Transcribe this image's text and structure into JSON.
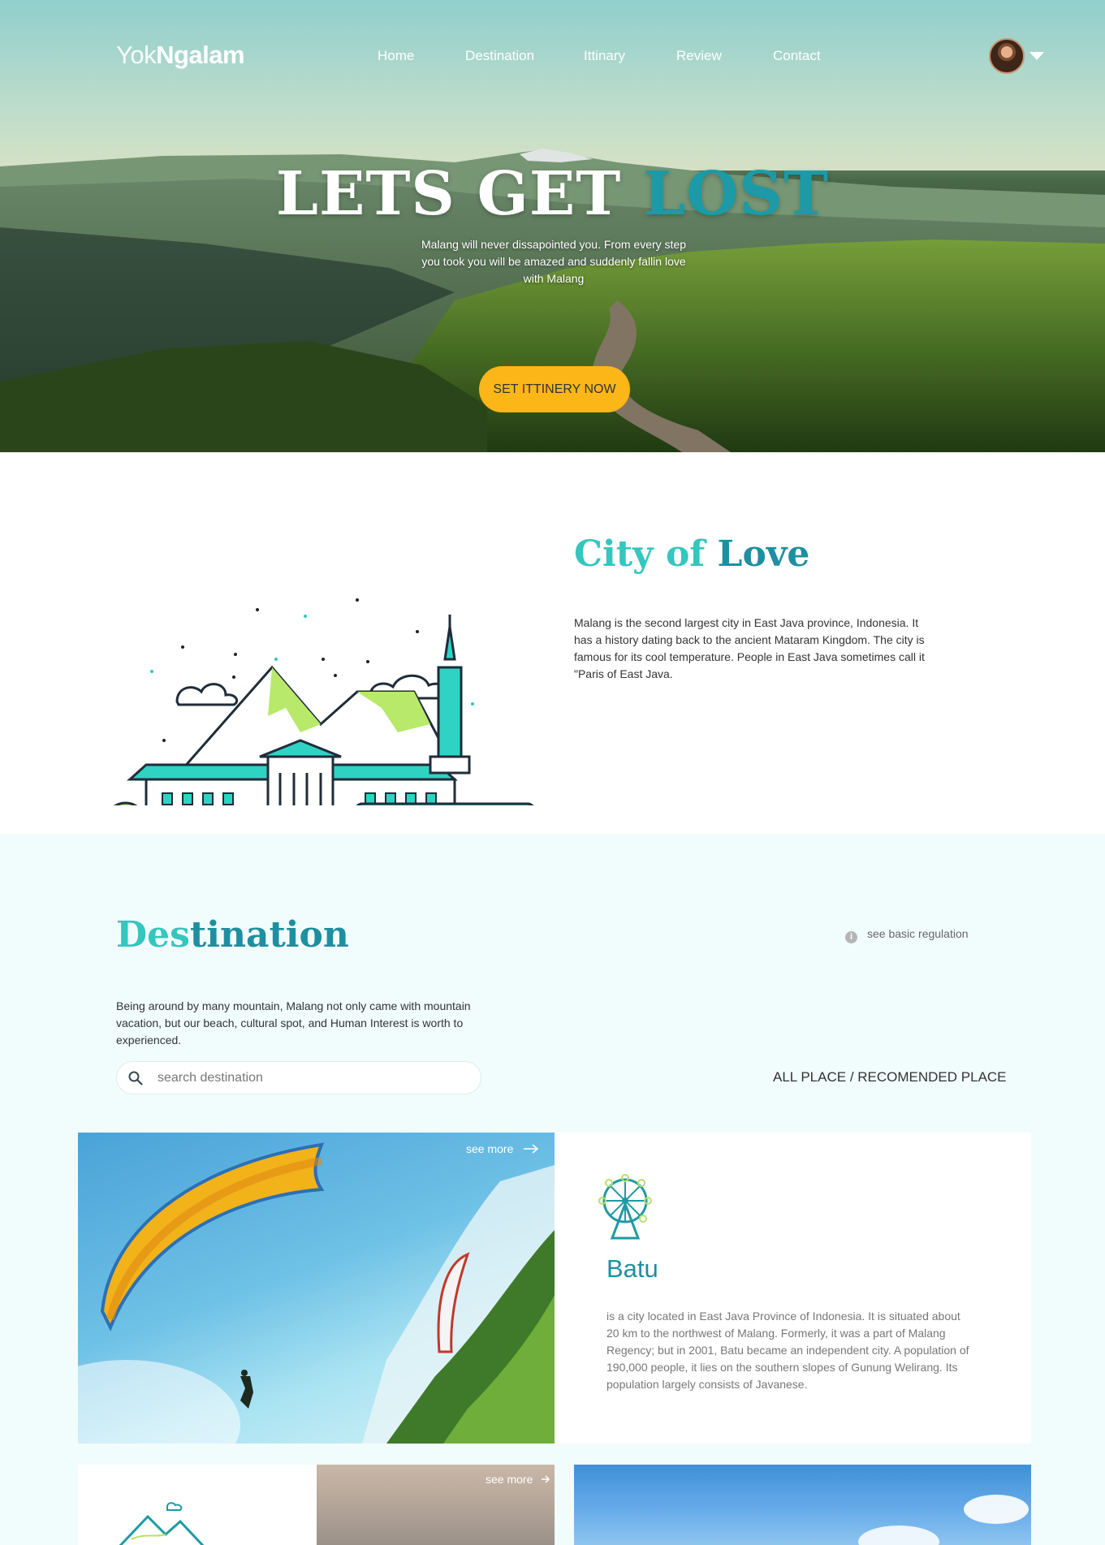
{
  "brand": {
    "logo_light": "Yok",
    "logo_bold": "Ngalam"
  },
  "nav": {
    "items": [
      "Home",
      "Destination",
      "Ittinary",
      "Review",
      "Contact"
    ]
  },
  "hero": {
    "title_main": "LETS GET ",
    "title_accent": "LOST",
    "subtitle": "Malang will never dissapointed you. From every step you took you will be amazed and suddenly fallin love with Malang",
    "cta_label": "SET ITTINERY NOW"
  },
  "city": {
    "title_a": "City of ",
    "title_b": "Love",
    "description": "Malang is the second largest city in East Java province, Indonesia. It has a history dating back to the ancient Mataram Kingdom. The city is famous for its cool temperature. People in East Java sometimes call it \"Paris of East Java."
  },
  "destination": {
    "title_a": "Des",
    "title_b": "tination",
    "regulation_link": "see basic regulation",
    "description": "Being around by many mountain, Malang not only came with mountain vacation, but our beach, cultural spot, and Human Interest is worth to experienced.",
    "search_placeholder": "search destination",
    "filter_all": "ALL PLACE",
    "filter_sep": " / ",
    "filter_recommended": "RECOMENDED PLACE"
  },
  "cards": {
    "see_more": "see more",
    "featured": {
      "name": "Batu",
      "description": "is a city located in East Java Province of Indonesia. It is situated about 20 km to the northwest of Malang. Formerly, it was a part of Malang Regency; but in 2001, Batu became an independent city. A population of 190,000 people, it lies on the southern slopes of Gunung Welirang. Its population largely consists of Javanese."
    }
  },
  "colors": {
    "teal_light": "#35c6bf",
    "teal_dark": "#1e8fa0",
    "cta_yellow": "#fdb617",
    "section_bg": "#f1fdfc"
  },
  "icons": {
    "avatar_caret": "chevron-down-icon",
    "regulation": "info-icon",
    "search": "search-icon",
    "see_more": "arrow-right-icon",
    "featured_card": "ferris-wheel-icon",
    "small_card": "mountain-icon"
  }
}
